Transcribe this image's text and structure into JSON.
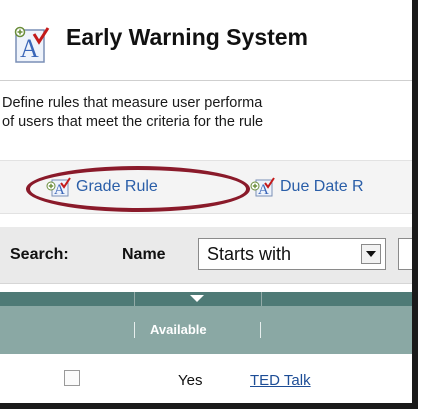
{
  "header": {
    "title": "Early Warning System",
    "icon": "document-rule-icon"
  },
  "description": {
    "line1": "Define rules that measure user performa",
    "line2": "of users that meet the criteria for the rule"
  },
  "toolbar": {
    "grade_rule_label": "Grade Rule",
    "due_date_rule_label": "Due Date R",
    "highlight_color": "#8a1a2a"
  },
  "search": {
    "label": "Search:",
    "field_label": "Name",
    "operator_value": "Starts with",
    "input_value": ""
  },
  "table": {
    "header_color": "#8aa8a4",
    "columns": [
      "",
      "Available",
      ""
    ],
    "rows": [
      {
        "checked": false,
        "available": "Yes",
        "title": "TED Talk"
      }
    ]
  },
  "colors": {
    "link": "#2a5ea8",
    "table_dark": "#4e7a76"
  }
}
